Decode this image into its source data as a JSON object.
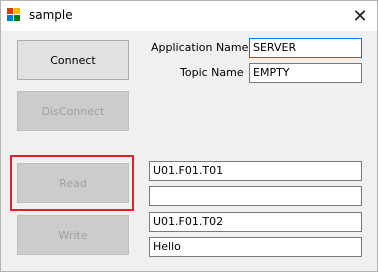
{
  "window": {
    "title": "sample",
    "close_glyph": "✕"
  },
  "buttons": {
    "connect": "Connect",
    "disconnect": "DisConnect",
    "read": "Read",
    "write": "Write"
  },
  "fields": {
    "application_name_label": "Application Name",
    "application_name_value": "SERVER",
    "topic_name_label": "Topic Name",
    "topic_name_value": "EMPTY",
    "read_item_value": "U01.F01.T01",
    "read_result_value": "",
    "write_item_value": "U01.F01.T02",
    "write_data_value": "Hello"
  },
  "colors": {
    "highlight_border": "#e0202a",
    "focus_border": "#0078d7"
  }
}
